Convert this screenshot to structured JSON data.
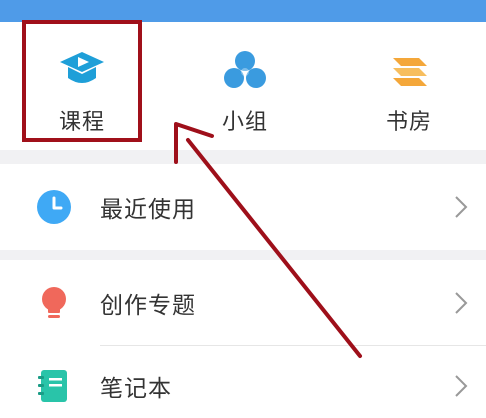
{
  "theme": {
    "top_bar_color": "#4f9be8",
    "highlight_color": "#a0101a",
    "arrow_color": "#9e0f1a",
    "section_gap_color": "#f1f1f3"
  },
  "quick_access": [
    {
      "label": "课程",
      "icon": "course-icon",
      "color": "#1e9fd8"
    },
    {
      "label": "小组",
      "icon": "group-icon",
      "color": "#3a9bdf"
    },
    {
      "label": "书房",
      "icon": "study-room-icon",
      "color": "#f4a73a"
    }
  ],
  "menu": [
    {
      "label": "最近使用",
      "icon": "clock-icon",
      "color": "#3fa9f5"
    },
    {
      "label": "创作专题",
      "icon": "lightbulb-icon",
      "color": "#f0685b"
    },
    {
      "label": "笔记本",
      "icon": "notebook-icon",
      "color": "#29c4a9"
    }
  ]
}
